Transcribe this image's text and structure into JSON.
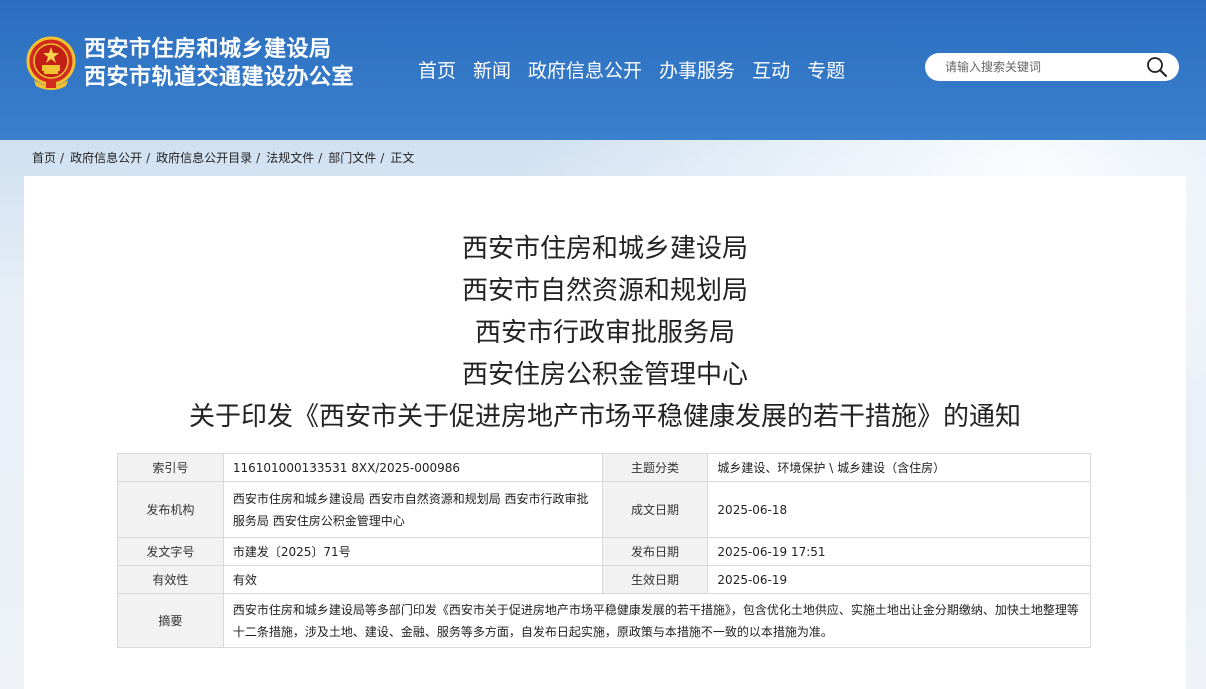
{
  "header": {
    "org_line1": "西安市住房和城乡建设局",
    "org_line2": "西安市轨道交通建设办公室",
    "emblem_icon": "national-emblem-icon",
    "nav": [
      "首页",
      "新闻",
      "政府信息公开",
      "办事服务",
      "互动",
      "专题"
    ],
    "search": {
      "placeholder": "请输入搜索关键词",
      "icon": "search-icon"
    },
    "colors": {
      "header_bg": "#2b6ec0",
      "text": "#ffffff"
    }
  },
  "breadcrumb": {
    "items": [
      "首页",
      "政府信息公开",
      "政府信息公开目录",
      "法规文件",
      "部门文件",
      "正文"
    ],
    "separator": "/"
  },
  "document": {
    "title_lines": [
      "西安市住房和城乡建设局",
      "西安市自然资源和规划局",
      "西安市行政审批服务局",
      "西安住房公积金管理中心",
      "关于印发《西安市关于促进房地产市场平稳健康发展的若干措施》的通知"
    ]
  },
  "meta": {
    "index_no_label": "索引号",
    "index_no": "116101000133531 8XX/2025-000986",
    "topic_label": "主题分类",
    "topic": "城乡建设、环境保护 \\ 城乡建设（含住房）",
    "issuer_label": "发布机构",
    "issuer": "西安市住房和城乡建设局 西安市自然资源和规划局 西安市行政审批服务局 西安住房公积金管理中心",
    "written_date_label": "成文日期",
    "written_date": "2025-06-18",
    "doc_no_label": "发文字号",
    "doc_no": "市建发〔2025〕71号",
    "publish_date_label": "发布日期",
    "publish_date": "2025-06-19 17:51",
    "validity_label": "有效性",
    "validity": "有效",
    "effective_date_label": "生效日期",
    "effective_date": "2025-06-19",
    "abstract_label": "摘要",
    "abstract": "西安市住房和城乡建设局等多部门印发《西安市关于促进房地产市场平稳健康发展的若干措施》，包含优化土地供应、实施土地出让金分期缴纳、加快土地整理等十二条措施，涉及土地、建设、金融、服务等多方面，自发布日起实施，原政策与本措施不一致的以本措施为准。"
  }
}
